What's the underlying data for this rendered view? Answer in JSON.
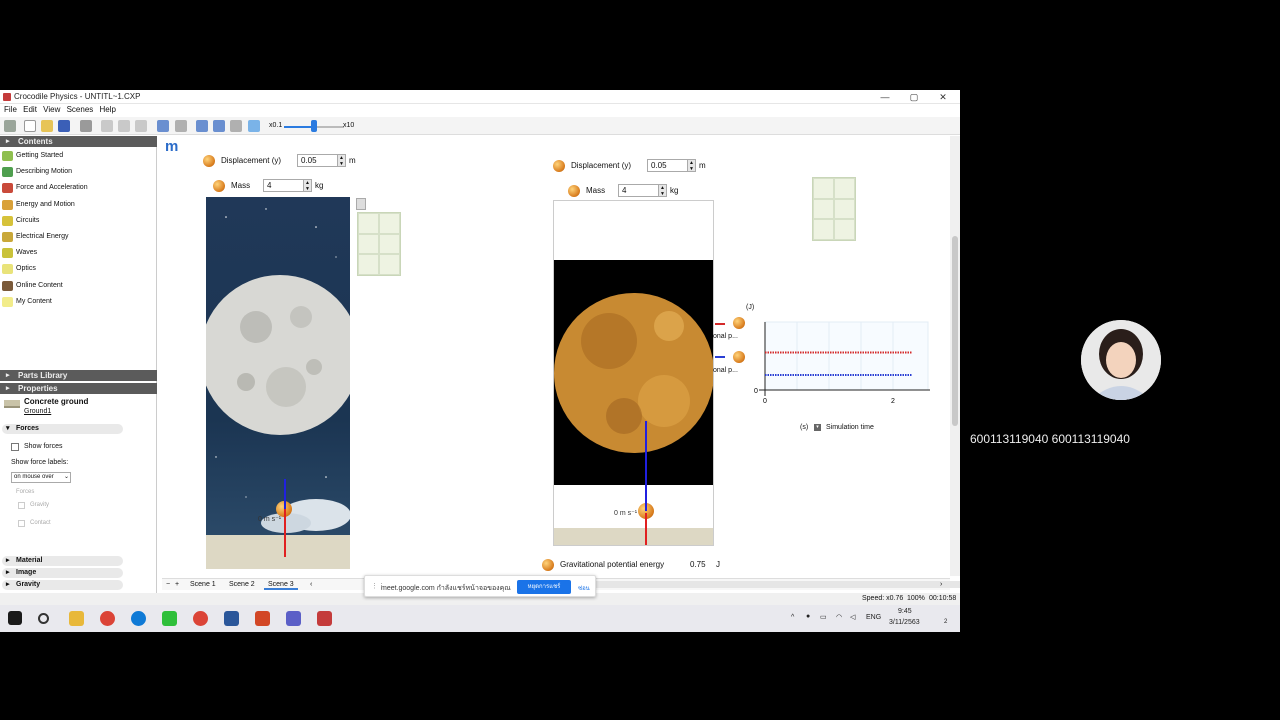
{
  "window": {
    "title": "Crocodile Physics - UNTITL~1.CXP",
    "controls": [
      "—",
      "▢",
      "✕"
    ]
  },
  "menu": [
    "File",
    "Edit",
    "View",
    "Scenes",
    "Help"
  ],
  "toolbar": {
    "speed_min": "x0.1",
    "speed_max": "x10",
    "speed_fraction": 0.5
  },
  "sidebar": {
    "contents_header": "Contents",
    "items": [
      {
        "label": "Getting Started",
        "color": "#8fbf4f"
      },
      {
        "label": "Describing Motion",
        "color": "#4f9f4f"
      },
      {
        "label": "Force and Acceleration",
        "color": "#c94a3a"
      },
      {
        "label": "Energy and Motion",
        "color": "#d9a13a"
      },
      {
        "label": "Circuits",
        "color": "#d6c23a"
      },
      {
        "label": "Electrical Energy",
        "color": "#c9a83a"
      },
      {
        "label": "Waves",
        "color": "#c9c23a"
      },
      {
        "label": "Optics",
        "color": "#e9e37a"
      },
      {
        "label": "Online Content",
        "color": "#7a5a3a"
      },
      {
        "label": "My Content",
        "color": "#f2ec8a"
      }
    ],
    "parts_header": "Parts Library",
    "properties_header": "Properties",
    "selected_name": "Concrete ground",
    "selected_id": "Ground1",
    "forces_section": "Forces",
    "show_forces": "Show forces",
    "show_force_labels": "Show force labels:",
    "force_labels_value": "on mouse over",
    "forces_group": "Forces",
    "gravity": "Gravity",
    "contact": "Contact",
    "material_section": "Material",
    "image_section": "Image",
    "gravity_section": "Gravity"
  },
  "workspace": {
    "logo": "m",
    "left_scene": {
      "displacement_label": "Displacement (y)",
      "displacement_value": "0.05",
      "displacement_unit": "m",
      "mass_label": "Mass",
      "mass_value": "4",
      "mass_unit": "kg",
      "ball_label": "0 m s⁻¹"
    },
    "right_scene": {
      "displacement_label": "Displacement (y)",
      "displacement_value": "0.05",
      "displacement_unit": "m",
      "mass_label": "Mass",
      "mass_value": "4",
      "mass_unit": "kg",
      "ball_label": "0 m s⁻¹",
      "gpe_label": "Gravitational potential energy",
      "gpe_value": "0.75",
      "gpe_unit": "J"
    },
    "graph": {
      "y_unit": "(J)",
      "legend_1": "onal p...",
      "legend_2": "onal p...",
      "x_unit": "(s)",
      "x_title": "Simulation time",
      "tick_0": "0",
      "tick_x0": "0",
      "tick_x2": "2",
      "series_colors": [
        "#d42a2a",
        "#2a3fd4"
      ]
    }
  },
  "chart_data": {
    "type": "line",
    "xlabel": "Simulation time",
    "x_unit": "(s)",
    "ylabel": "(J)",
    "xlim": [
      0,
      2.5
    ],
    "series": [
      {
        "x": [
          0,
          2.3
        ],
        "values": [
          0.75,
          0.75
        ],
        "color": "#d42a2a"
      },
      {
        "x": [
          0,
          2.3
        ],
        "values": [
          0.3,
          0.3
        ],
        "color": "#2a3fd4"
      }
    ]
  },
  "scenes": {
    "tabs": [
      "Scene 1",
      "Scene 2",
      "Scene 3"
    ],
    "active": 2
  },
  "status": {
    "speed": "Speed: x0.76",
    "zoom": "100%",
    "time": "00:10:58"
  },
  "meet": {
    "share_text": "meet.google.com กำลังแชร์หน้าจอของคุณ",
    "stop_button": "หยุดการแชร์",
    "hide_button": "ซ่อน",
    "participant": "600113119040 600113119040"
  },
  "taskbar": {
    "lang": "ENG",
    "clock_time": "9:45",
    "clock_date": "3/11/2563",
    "notif_count": "2"
  }
}
